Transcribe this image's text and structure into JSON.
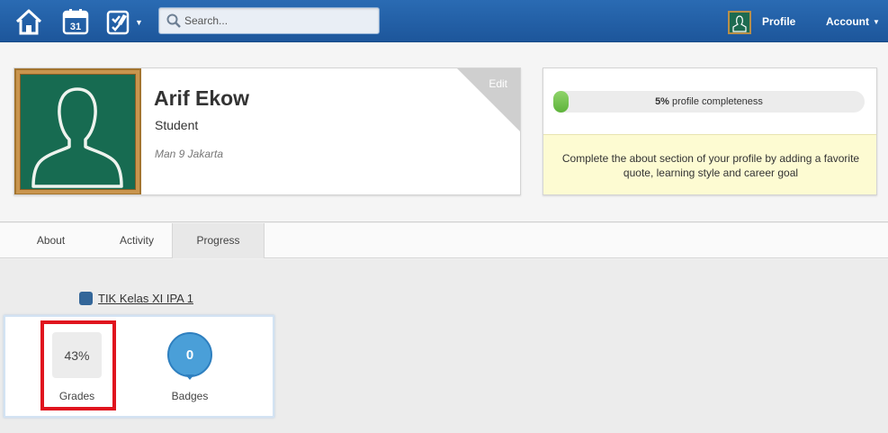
{
  "topbar": {
    "icons": [
      "home-icon",
      "calendar-icon",
      "tasks-icon"
    ],
    "calendar_day": "31",
    "search_placeholder": "Search...",
    "profile_label": "Profile",
    "account_label": "Account",
    "colors": {
      "bar": "#1d569b"
    }
  },
  "profile": {
    "name": "Arif Ekow",
    "role": "Student",
    "school": "Man 9 Jakarta",
    "edit_label": "Edit"
  },
  "completeness": {
    "percent": 5,
    "percent_label": "5%",
    "label": "profile completeness",
    "hint": "Complete the about section of your profile by adding a favorite quote, learning style and career goal"
  },
  "tabs": [
    {
      "label": "About"
    },
    {
      "label": "Activity"
    },
    {
      "label": "Progress",
      "active": true
    }
  ],
  "course": {
    "name": "TIK Kelas XI IPA 1",
    "swatch_color": "#336699"
  },
  "stats": {
    "grade_value": "43%",
    "grade_label": "Grades",
    "badge_count": "0",
    "badge_label": "Badges",
    "highlight_color": "#e0141e"
  }
}
